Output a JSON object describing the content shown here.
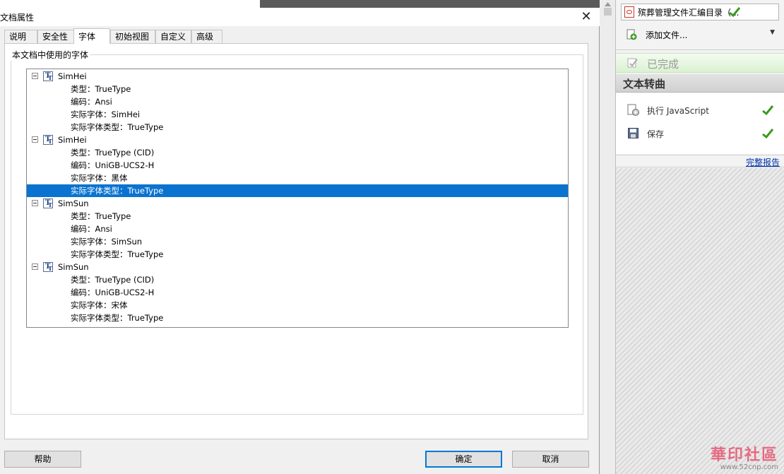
{
  "dialog": {
    "title": "文档属性",
    "tabs": [
      "说明",
      "安全性",
      "字体",
      "初始视图",
      "自定义",
      "高级"
    ],
    "active_tab": "字体",
    "group_label": "本文档中使用的字体",
    "fonts": [
      {
        "name": "SimHei",
        "props": [
          "类型：TrueType",
          "编码：Ansi",
          "实际字体：SimHei",
          "实际字体类型：TrueType"
        ]
      },
      {
        "name": "SimHei",
        "props": [
          "类型：TrueType (CID)",
          "编码：UniGB-UCS2-H",
          "实际字体：黑体",
          "实际字体类型：TrueType"
        ]
      },
      {
        "name": "SimSun",
        "props": [
          "类型：TrueType",
          "编码：Ansi",
          "实际字体：SimSun",
          "实际字体类型：TrueType"
        ]
      },
      {
        "name": "SimSun",
        "props": [
          "类型：TrueType (CID)",
          "编码：UniGB-UCS2-H",
          "实际字体：宋体",
          "实际字体类型：TrueType"
        ]
      }
    ],
    "buttons": {
      "help": "帮助",
      "ok": "确定",
      "cancel": "取消"
    }
  },
  "right_pane": {
    "document_name": "殡葬管理文件汇编目录（...",
    "add_files": "添加文件...",
    "status": "已完成",
    "section_title": "文本转曲",
    "actions": [
      "执行 JavaScript",
      "保存"
    ],
    "report_link": "完整报告"
  },
  "watermark": {
    "main": "華印社區",
    "sub": "www.52cnp.com"
  },
  "colors": {
    "selection": "#0a73d0",
    "check": "#3a9a1e",
    "link": "#0033aa"
  }
}
